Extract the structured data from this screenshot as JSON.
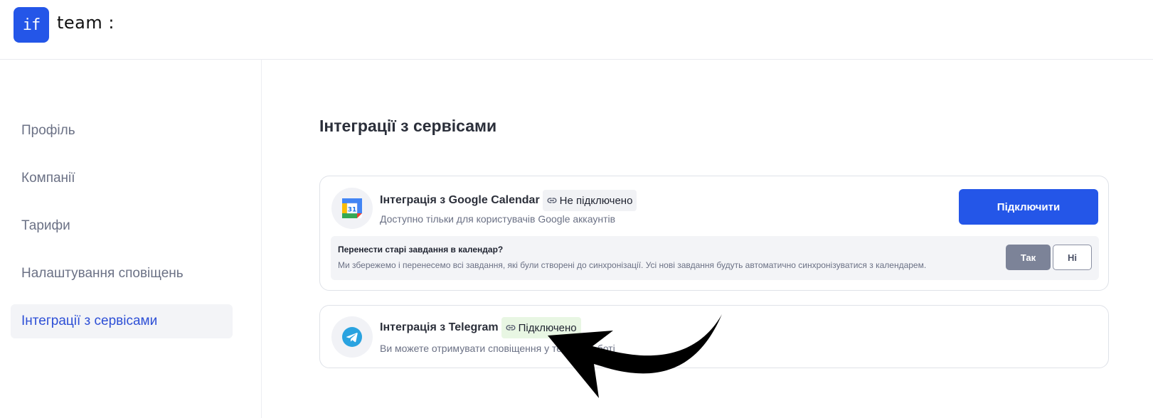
{
  "header": {
    "logo_mark": "if",
    "logo_text": "team :"
  },
  "sidebar": {
    "items": [
      {
        "label": "Профіль",
        "active": false
      },
      {
        "label": "Компанії",
        "active": false
      },
      {
        "label": "Тарифи",
        "active": false
      },
      {
        "label": "Налаштування сповіщень",
        "active": false
      },
      {
        "label": "Інтеграції з сервісами",
        "active": true
      }
    ]
  },
  "main": {
    "title": "Інтеграції з сервісами",
    "google": {
      "title": "Інтеграція з Google Calendar",
      "status": "Не підключено",
      "subtitle": "Доступно тільки для користувачів Google аккаунтів",
      "connect_label": "Підключити",
      "icon": "google-calendar-icon",
      "migrate": {
        "question": "Перенести старі завдання в календар?",
        "description": "Ми збережемо і перенесемо всі завдання, які були створені до синхронізації. Усі нові завдання будуть автоматично синхронізуватися з календарем.",
        "yes_label": "Так",
        "no_label": "Ні"
      }
    },
    "telegram": {
      "title": "Інтеграція з Telegram",
      "status": "Підключено",
      "subtitle": "Ви можете отримувати сповіщення у телеграм боті",
      "icon": "telegram-icon"
    }
  },
  "colors": {
    "accent": "#2456e8",
    "active_nav_text": "#2d4fd6",
    "connected_badge_bg": "#e8f6e3",
    "yes_button_bg": "#7c8398"
  }
}
